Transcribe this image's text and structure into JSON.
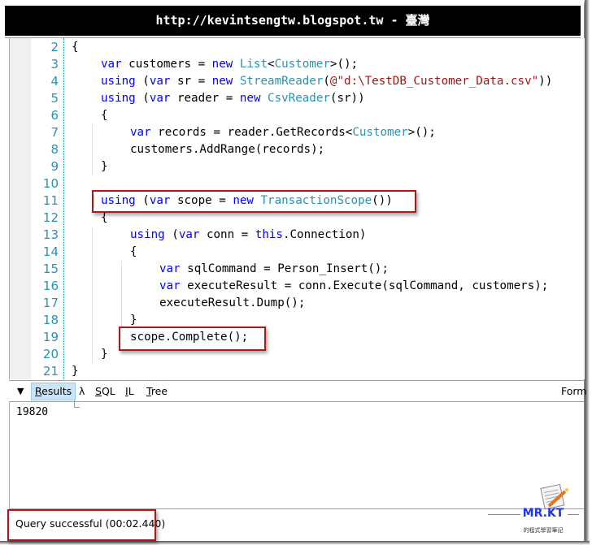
{
  "banner": {
    "text": "http://kevintsengtw.blogspot.tw - 臺灣"
  },
  "editor": {
    "lines": [
      {
        "no": "2",
        "indent": 0,
        "tokens": [
          [
            "p",
            "{"
          ]
        ]
      },
      {
        "no": "3",
        "indent": 1,
        "tokens": [
          [
            "kw",
            "var"
          ],
          [
            "p",
            " customers = "
          ],
          [
            "kw",
            "new"
          ],
          [
            "p",
            " "
          ],
          [
            "ty",
            "List"
          ],
          [
            "p",
            "<"
          ],
          [
            "ty",
            "Customer"
          ],
          [
            "p",
            ">();"
          ]
        ]
      },
      {
        "no": "4",
        "indent": 1,
        "tokens": [
          [
            "kw",
            "using"
          ],
          [
            "p",
            " ("
          ],
          [
            "kw",
            "var"
          ],
          [
            "p",
            " sr = "
          ],
          [
            "kw",
            "new"
          ],
          [
            "p",
            " "
          ],
          [
            "ty",
            "StreamReader"
          ],
          [
            "p",
            "("
          ],
          [
            "str",
            "@\"d:\\TestDB_Customer_Data.csv\""
          ],
          [
            "p",
            "))"
          ]
        ]
      },
      {
        "no": "5",
        "indent": 1,
        "tokens": [
          [
            "kw",
            "using"
          ],
          [
            "p",
            " ("
          ],
          [
            "kw",
            "var"
          ],
          [
            "p",
            " reader = "
          ],
          [
            "kw",
            "new"
          ],
          [
            "p",
            " "
          ],
          [
            "ty",
            "CsvReader"
          ],
          [
            "p",
            "(sr))"
          ]
        ]
      },
      {
        "no": "6",
        "indent": 1,
        "tokens": [
          [
            "p",
            "{"
          ]
        ]
      },
      {
        "no": "7",
        "indent": 2,
        "tokens": [
          [
            "kw",
            "var"
          ],
          [
            "p",
            " records = reader.GetRecords<"
          ],
          [
            "ty",
            "Customer"
          ],
          [
            "p",
            ">();"
          ]
        ]
      },
      {
        "no": "8",
        "indent": 2,
        "tokens": [
          [
            "p",
            "customers.AddRange(records);"
          ]
        ]
      },
      {
        "no": "9",
        "indent": 1,
        "tokens": [
          [
            "p",
            "}"
          ]
        ]
      },
      {
        "no": "10",
        "indent": 0,
        "tokens": []
      },
      {
        "no": "11",
        "indent": 1,
        "tokens": [
          [
            "kw",
            "using"
          ],
          [
            "p",
            " ("
          ],
          [
            "kw",
            "var"
          ],
          [
            "p",
            " scope = "
          ],
          [
            "kw",
            "new"
          ],
          [
            "p",
            " "
          ],
          [
            "ty",
            "TransactionScope"
          ],
          [
            "p",
            "())"
          ]
        ]
      },
      {
        "no": "12",
        "indent": 1,
        "tokens": [
          [
            "p",
            "{"
          ]
        ]
      },
      {
        "no": "13",
        "indent": 2,
        "tokens": [
          [
            "kw",
            "using"
          ],
          [
            "p",
            " ("
          ],
          [
            "kw",
            "var"
          ],
          [
            "p",
            " conn = "
          ],
          [
            "kw",
            "this"
          ],
          [
            "p",
            ".Connection)"
          ]
        ]
      },
      {
        "no": "14",
        "indent": 2,
        "tokens": [
          [
            "p",
            "{"
          ]
        ]
      },
      {
        "no": "15",
        "indent": 3,
        "tokens": [
          [
            "kw",
            "var"
          ],
          [
            "p",
            " sqlCommand = Person_Insert();"
          ]
        ]
      },
      {
        "no": "16",
        "indent": 3,
        "tokens": [
          [
            "kw",
            "var"
          ],
          [
            "p",
            " executeResult = conn.Execute(sqlCommand, customers);"
          ]
        ]
      },
      {
        "no": "17",
        "indent": 3,
        "tokens": [
          [
            "p",
            "executeResult.Dump();"
          ]
        ]
      },
      {
        "no": "18",
        "indent": 2,
        "tokens": [
          [
            "p",
            "}"
          ]
        ]
      },
      {
        "no": "19",
        "indent": 2,
        "tokens": [
          [
            "p",
            "scope.Complete();"
          ]
        ]
      },
      {
        "no": "20",
        "indent": 1,
        "tokens": [
          [
            "p",
            "}"
          ]
        ]
      },
      {
        "no": "21",
        "indent": 0,
        "tokens": [
          [
            "p",
            "}"
          ]
        ]
      }
    ]
  },
  "results_bar": {
    "collapse_icon": "triangle-down-icon",
    "tabs": [
      {
        "label": "Results",
        "mnemonic": "R",
        "rest": "esults",
        "active": true
      },
      {
        "label": "λ",
        "mnemonic": "",
        "rest": "λ",
        "active": false
      },
      {
        "label": "SQL",
        "mnemonic": "S",
        "rest": "QL",
        "active": false
      },
      {
        "label": "IL",
        "mnemonic": "I",
        "rest": "L",
        "active": false
      },
      {
        "label": "Tree",
        "mnemonic": "T",
        "rest": "ree",
        "active": false
      }
    ],
    "format_label": "Form"
  },
  "output": {
    "value": "19820"
  },
  "status": {
    "text": "Query successful  (00:02.440)"
  },
  "watermark": {
    "title": "MR.KT",
    "subtitle": "的程式學習筆記"
  },
  "colors": {
    "keyword": "#0000ff",
    "type": "#2b91af",
    "string": "#a31515",
    "highlight_box": "#b01818",
    "active_tab": "#cce4f7"
  }
}
